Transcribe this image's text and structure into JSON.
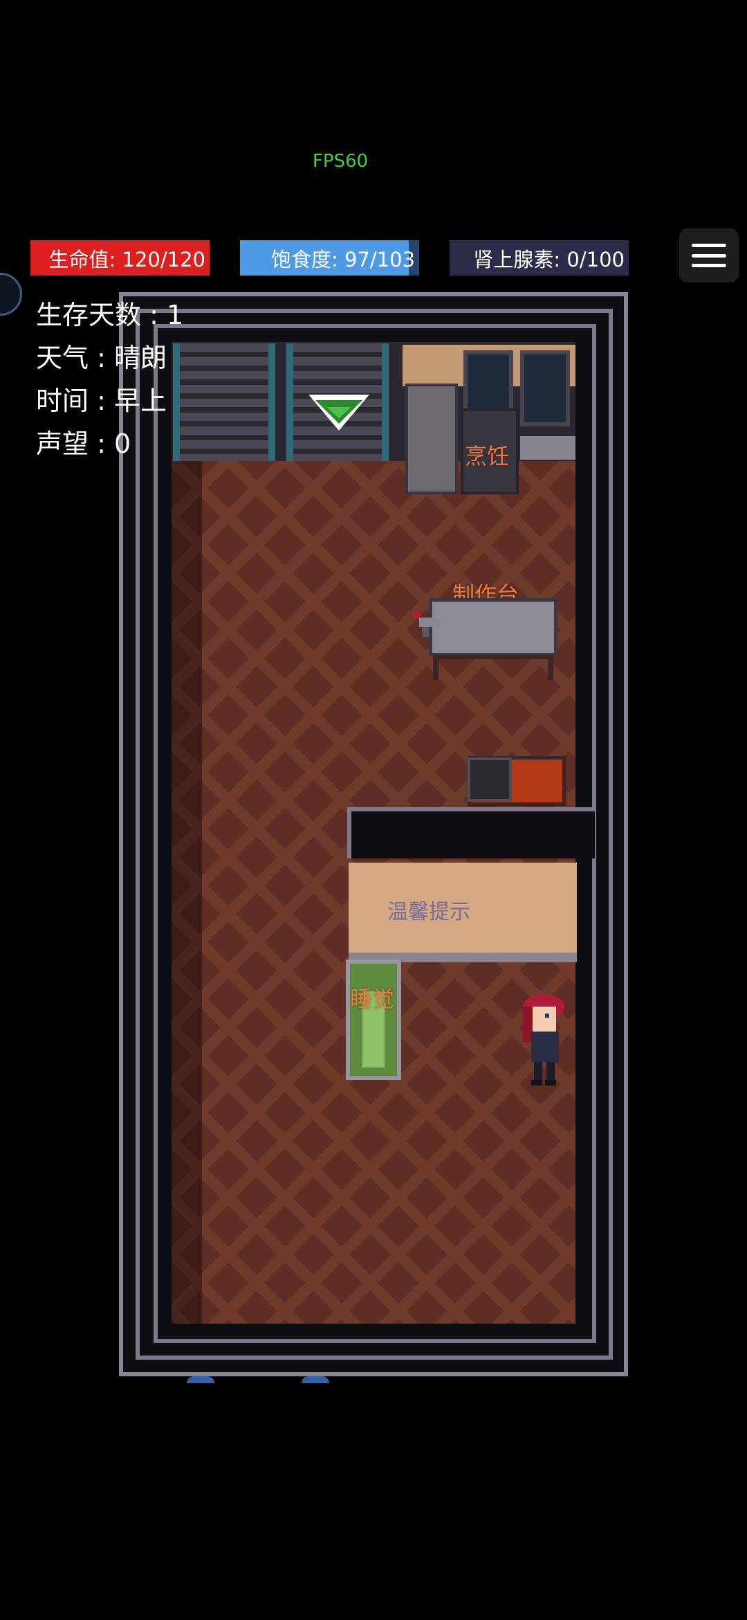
{
  "fps": "FPS60",
  "stats": {
    "hp": {
      "label": "生命值",
      "value": "120/120",
      "current": 120,
      "max": 120,
      "color": "#dc1f1f"
    },
    "food": {
      "label": "饱食度",
      "value": "97/103",
      "current": 97,
      "max": 103,
      "color": "#4e9ae4"
    },
    "adrenaline": {
      "label": "肾上腺素",
      "value": "0/100",
      "current": 0,
      "max": 100,
      "color": "#ff7a1a"
    }
  },
  "info": {
    "days": "生存天数 : 1",
    "weather": "天气 : 晴朗",
    "time": "时间 : 早上",
    "reputation": "声望 : 0"
  },
  "map": {
    "cooking": "烹饪",
    "crafting": "制作台",
    "tips": "温馨提示",
    "sleep": "睡觉"
  },
  "icons": {
    "menu": "hamburger-menu-icon",
    "side": "circle-button-icon",
    "arrow": "down-arrow-marker"
  }
}
